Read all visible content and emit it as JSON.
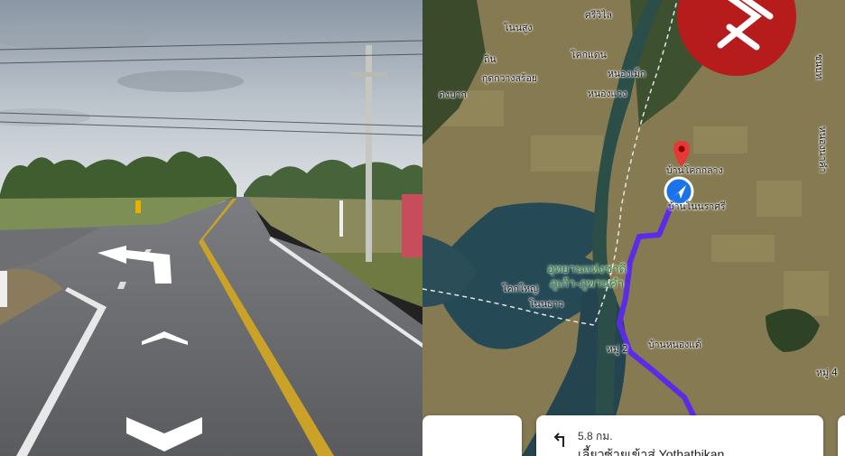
{
  "map": {
    "labels": [
      {
        "id": "nonsung",
        "text": "โนนสูง"
      },
      {
        "id": "sriwilai",
        "text": "ศรีวิไล"
      },
      {
        "id": "tin",
        "text": "ถิ่น"
      },
      {
        "id": "koktandan",
        "text": "โคกแดน"
      },
      {
        "id": "kudkwang",
        "text": "กุดกวางสร้อย"
      },
      {
        "id": "nongmek",
        "text": "หนองเม็ก"
      },
      {
        "id": "dongbak",
        "text": "ดงบาก"
      },
      {
        "id": "nongwaeng",
        "text": "หนองแวง"
      },
      {
        "id": "koklang",
        "text": "บ้านโคกกลาง"
      },
      {
        "id": "nonrasri",
        "text": "บ้านโนนราศรี"
      },
      {
        "id": "kokyai",
        "text": "โคกใหญ่"
      },
      {
        "id": "nontao",
        "text": "โนนธาว"
      },
      {
        "id": "nongdae",
        "text": "บ้านหนองแด้"
      },
      {
        "id": "moo2",
        "text": "หมู่ 2"
      },
      {
        "id": "moo4",
        "text": "หมู่ 4"
      },
      {
        "id": "chonnabot",
        "text": "ชนบท"
      },
      {
        "id": "right_edge",
        "text": "หนองนาคำ"
      }
    ],
    "park_name_line1": "อุทยานแห่งชาติ",
    "park_name_line2": "ภูเก้า-ภูพานคำ",
    "brand_color": "#b71c1c",
    "route_color": "#5b2be8",
    "direction_card": {
      "distance": "5.8 กม.",
      "instruction": "เลี้ยวซ้ายเข้าสู่ Yothathikan"
    }
  }
}
